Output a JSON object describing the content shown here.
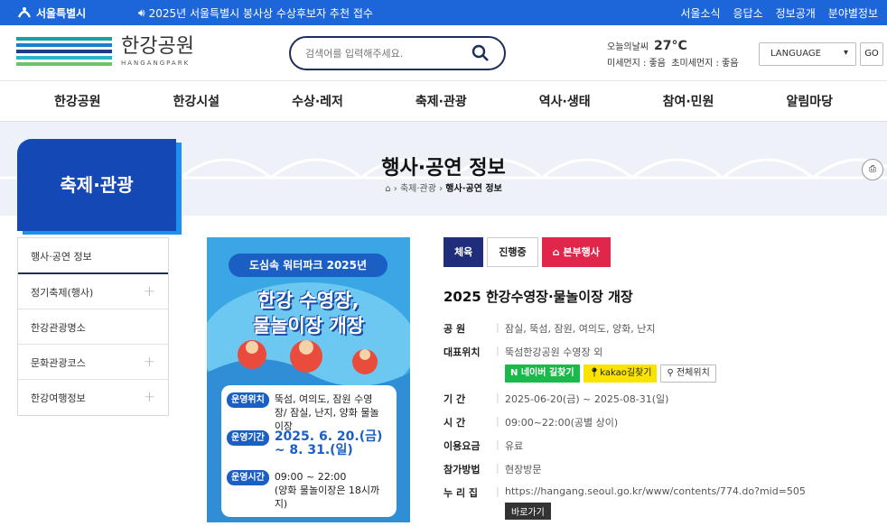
{
  "topbar": {
    "logo_text": "서울특별시",
    "notice": "2025년 서울특별시 봉사상 수상후보자 추천 접수",
    "links": [
      "서울소식",
      "응답소",
      "정보공개",
      "분야별정보"
    ]
  },
  "header": {
    "brand_name": "한강공원",
    "brand_sub": "HANGANGPARK",
    "search_placeholder": "검색어를 입력해주세요.",
    "weather_label": "오늘의날씨",
    "temperature": "27°C",
    "dust": "미세먼지 : 좋음",
    "ultrafine_dust": "초미세먼지 : 좋음",
    "language_label": "LANGUAGE",
    "go_label": "GO"
  },
  "gnb": [
    "한강공원",
    "한강시설",
    "수상·레저",
    "축제·관광",
    "역사·생태",
    "참여·민원",
    "알림마당"
  ],
  "section": {
    "box_title": "축제·관광",
    "page_title": "행사·공연 정보",
    "breadcrumb": [
      "축제·관광",
      "행사·공연 정보"
    ]
  },
  "side_menu": [
    {
      "label": "행사·공연 정보",
      "active": true,
      "expandable": false
    },
    {
      "label": "정기축제(행사)",
      "active": false,
      "expandable": true
    },
    {
      "label": "한강관광명소",
      "active": false,
      "expandable": false
    },
    {
      "label": "문화관광코스",
      "active": false,
      "expandable": true
    },
    {
      "label": "한강여행정보",
      "active": false,
      "expandable": true
    }
  ],
  "poster": {
    "pill": "도심속 워터파크 2025년",
    "title_line1": "한강 수영장,",
    "title_line2": "물놀이장 개장",
    "location_tag": "운영위치",
    "location": "뚝섬, 여의도, 잠원 수영장/ 잠실, 난지, 양화 물놀이장",
    "period_tag": "운영기간",
    "period_start": "2025. 6. 20.(금)",
    "period_end": "~ 8. 31.(일)",
    "hours_tag": "운영시간",
    "hours": "09:00 ~ 22:00",
    "hours_note": "(양화 물놀이장은 18시까지)"
  },
  "event": {
    "badges": [
      "체육",
      "진행중",
      "본부행사"
    ],
    "title": "2025 한강수영장·물놀이장 개장",
    "fields": [
      {
        "key": "공 원",
        "value": "잠실, 뚝섬, 잠원, 여의도, 양화, 난지"
      },
      {
        "key": "대표위치",
        "value": "뚝섬한강공원 수영장 외"
      },
      {
        "key": "기 간",
        "value": "2025-06-20(금) ~ 2025-08-31(일)"
      },
      {
        "key": "시 간",
        "value": "09:00~22:00(공별 상이)"
      },
      {
        "key": "이용요금",
        "value": "유료"
      },
      {
        "key": "참가방법",
        "value": "현장방문"
      },
      {
        "key": "누 리 집",
        "value": "https://hangang.seoul.go.kr/www/contents/774.do?mid=505"
      }
    ],
    "map_buttons": [
      "네이버 길찾기",
      "kakao길찾기",
      "전체위치"
    ],
    "go_button": "바로가기"
  },
  "colors": {
    "top_blue": "#1c66d9",
    "nav_dark": "#1f2d5a",
    "badge_navy": "#1f2d7a",
    "badge_red": "#e1264c",
    "naver_green": "#19b94a",
    "kakao_yellow": "#fbe300"
  }
}
